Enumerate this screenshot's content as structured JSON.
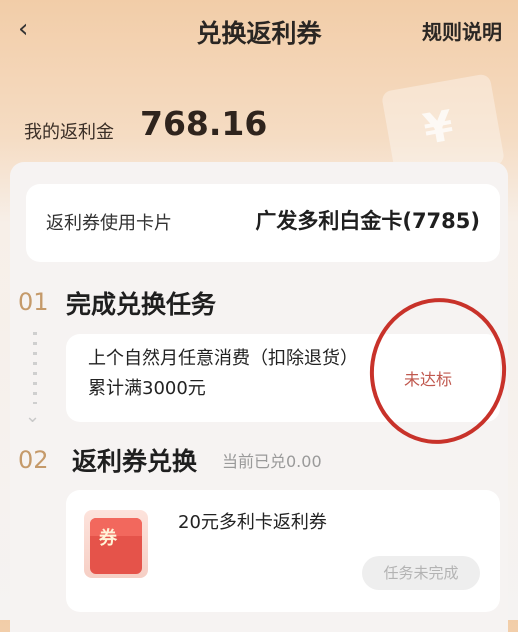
{
  "header": {
    "back_icon": "‹",
    "title": "兑换返利券",
    "rules_link": "规则说明"
  },
  "balance": {
    "label": "我的返利金",
    "value": "768.16",
    "decor_symbol": "¥"
  },
  "card_info": {
    "label": "返利券使用卡片",
    "value": "广发多利白金卡(7785)"
  },
  "steps": [
    {
      "number": "01",
      "title": "完成兑换任务",
      "task_description": "上个自然月任意消费（扣除退货）累计满3000元",
      "status": "未达标"
    },
    {
      "number": "02",
      "title": "返利券兑换",
      "redeemed_text": "当前已兑0.00",
      "coupon_icon_glyph": "券",
      "coupon_title": "20元多利卡返利券",
      "button_label": "任务未完成"
    }
  ],
  "colors": {
    "accent_orange": "#c59a6a",
    "status_red": "#c0584e",
    "annotation_circle": "#c8322a"
  }
}
